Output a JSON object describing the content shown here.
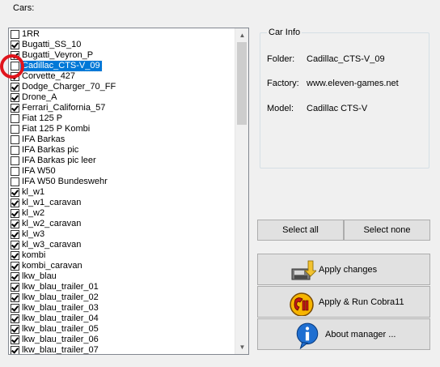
{
  "cars": {
    "legend": "Cars:",
    "items": [
      {
        "label": "1RR",
        "checked": false
      },
      {
        "label": "Bugatti_SS_10",
        "checked": true
      },
      {
        "label": "Bugatti_Veyron_P",
        "checked": true
      },
      {
        "label": "Cadillac_CTS-V_09",
        "checked": false,
        "selected": true
      },
      {
        "label": "Corvette_427",
        "checked": true
      },
      {
        "label": "Dodge_Charger_70_FF",
        "checked": true
      },
      {
        "label": "Drone_A",
        "checked": true
      },
      {
        "label": "Ferrari_California_57",
        "checked": true
      },
      {
        "label": "Fiat 125 P",
        "checked": false
      },
      {
        "label": "Fiat 125 P Kombi",
        "checked": false
      },
      {
        "label": "IFA Barkas",
        "checked": false
      },
      {
        "label": "IFA Barkas pic",
        "checked": false
      },
      {
        "label": "IFA Barkas pic leer",
        "checked": false
      },
      {
        "label": "IFA W50",
        "checked": false
      },
      {
        "label": "IFA W50 Bundeswehr",
        "checked": false
      },
      {
        "label": "kl_w1",
        "checked": true
      },
      {
        "label": "kl_w1_caravan",
        "checked": true
      },
      {
        "label": "kl_w2",
        "checked": true
      },
      {
        "label": "kl_w2_caravan",
        "checked": true
      },
      {
        "label": "kl_w3",
        "checked": true
      },
      {
        "label": "kl_w3_caravan",
        "checked": true
      },
      {
        "label": "kombi",
        "checked": true
      },
      {
        "label": "kombi_caravan",
        "checked": true
      },
      {
        "label": "lkw_blau",
        "checked": true
      },
      {
        "label": "lkw_blau_trailer_01",
        "checked": true
      },
      {
        "label": "lkw_blau_trailer_02",
        "checked": true
      },
      {
        "label": "lkw_blau_trailer_03",
        "checked": true
      },
      {
        "label": "lkw_blau_trailer_04",
        "checked": true
      },
      {
        "label": "lkw_blau_trailer_05",
        "checked": true
      },
      {
        "label": "lkw_blau_trailer_06",
        "checked": true
      },
      {
        "label": "lkw_blau_trailer_07",
        "checked": true
      }
    ]
  },
  "car_info": {
    "legend": "Car Info",
    "folder_label": "Folder:",
    "folder_value": "Cadillac_CTS-V_09",
    "factory_label": "Factory:",
    "factory_value": "www.eleven-games.net",
    "model_label": "Model:",
    "model_value": "Cadillac CTS-V"
  },
  "buttons": {
    "select_all": "Select all",
    "select_none": "Select none",
    "apply_changes": "Apply changes",
    "apply_run": "Apply & Run Cobra11",
    "about": "About manager ..."
  },
  "icons": {
    "apply": "floppy-disk-apply-icon",
    "run": "cobra11-logo-icon",
    "about": "info-icon",
    "annotation": "red-circle-highlight"
  },
  "colors": {
    "selection": "#0078d7",
    "highlight_circle": "#e0141c",
    "window_bg": "#f0f0f0"
  }
}
